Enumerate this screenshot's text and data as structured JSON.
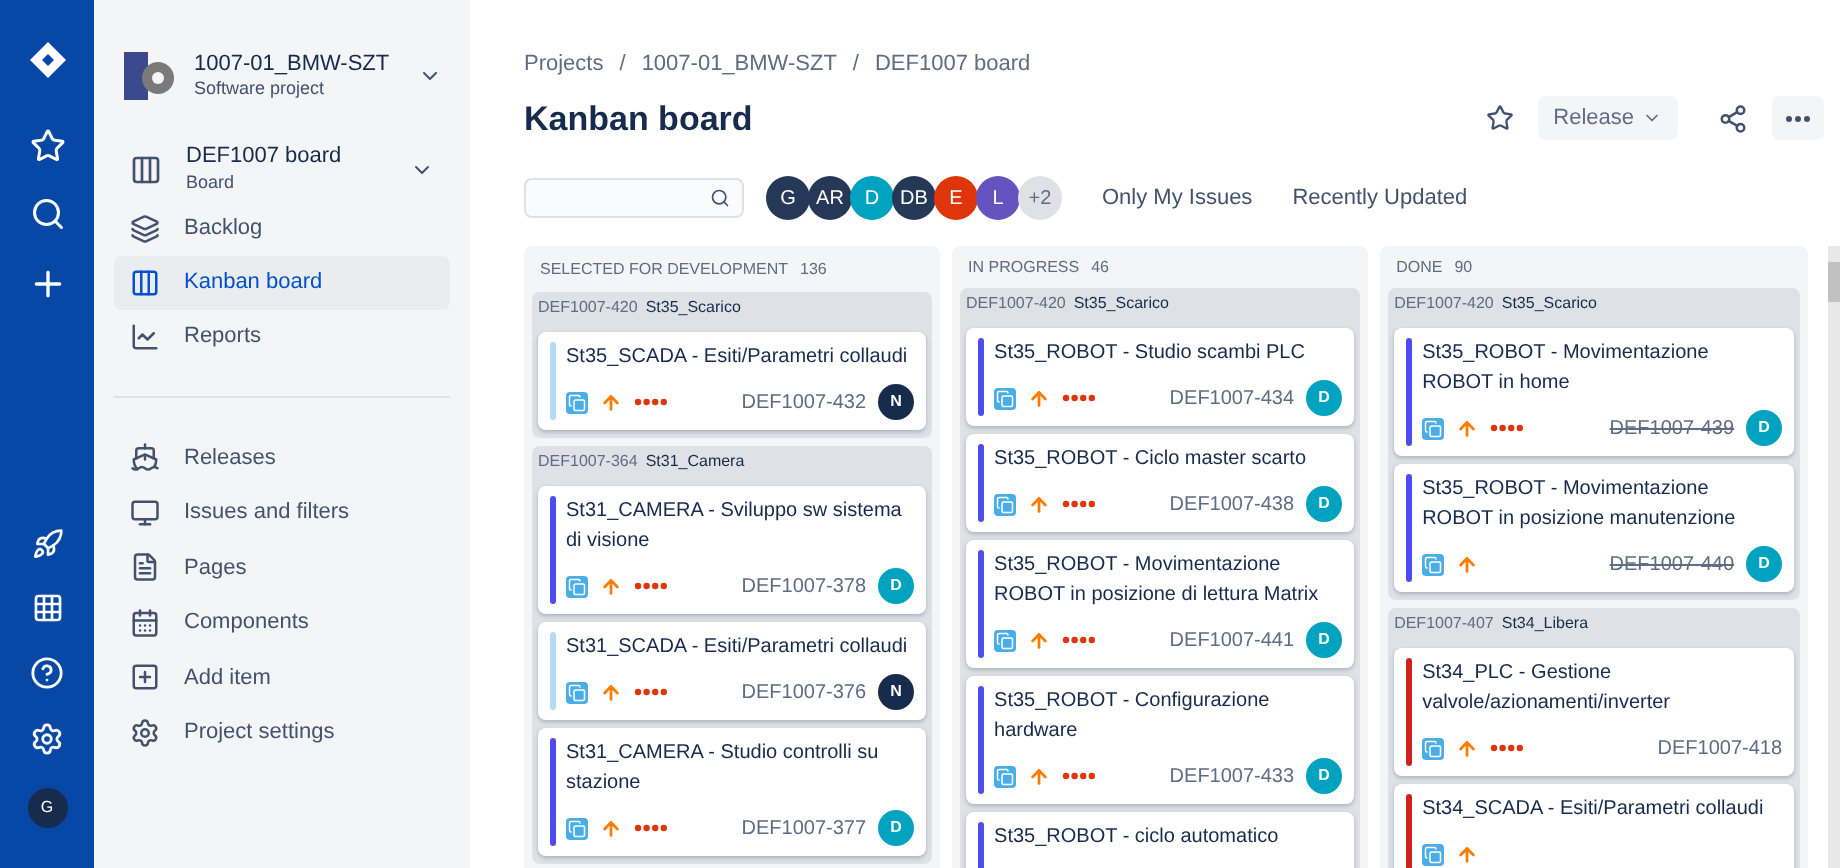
{
  "project": {
    "name": "1007-01_BMW-SZT",
    "type": "Software project"
  },
  "board_switcher": {
    "name": "DEF1007 board",
    "type": "Board"
  },
  "sidebar": {
    "items": [
      {
        "label": "Backlog",
        "selected": false
      },
      {
        "label": "Kanban board",
        "selected": true
      },
      {
        "label": "Reports",
        "selected": false
      }
    ],
    "items_2": [
      "Releases",
      "Issues and filters",
      "Pages",
      "Components",
      "Add item",
      "Project settings"
    ]
  },
  "global_nav": {
    "avatar": "G"
  },
  "breadcrumbs": [
    "Projects",
    "/",
    "1007-01_BMW-SZT",
    "/",
    "DEF1007 board"
  ],
  "title": "Kanban board",
  "release_button": "Release",
  "avatars": [
    {
      "label": "G",
      "color": "#253858"
    },
    {
      "label": "AR",
      "color": "#253858"
    },
    {
      "label": "D",
      "color": "#00a3bf"
    },
    {
      "label": "DB",
      "color": "#253858"
    },
    {
      "label": "E",
      "color": "#de350b"
    },
    {
      "label": "L",
      "color": "#6554c0"
    },
    {
      "label": "+2",
      "color": "#dfe1e6"
    }
  ],
  "quick_filters": [
    "Only My Issues",
    "Recently Updated"
  ],
  "columns": [
    {
      "title": "SELECTED FOR DEVELOPMENT",
      "count": "136",
      "lanes": [
        {
          "key": "DEF1007-420",
          "name": "St35_Scarico",
          "cards": [
            {
              "title": "St35_SCADA - Esiti/Parametri collaudi",
              "key": "DEF1007-432",
              "color": "#b3dcf5",
              "dots": true,
              "resolved": false,
              "avatar": {
                "label": "N",
                "color": "#172b4d"
              }
            }
          ]
        },
        {
          "key": "DEF1007-364",
          "name": "St31_Camera",
          "cards": [
            {
              "title": "St31_CAMERA - Sviluppo sw sistema di visione",
              "key": "DEF1007-378",
              "color": "#4c4cf0",
              "dots": true,
              "resolved": false,
              "avatar": {
                "label": "D",
                "color": "#00a3bf"
              }
            },
            {
              "title": "St31_SCADA - Esiti/Parametri collaudi",
              "key": "DEF1007-376",
              "color": "#b3dcf5",
              "dots": true,
              "resolved": false,
              "avatar": {
                "label": "N",
                "color": "#172b4d"
              }
            },
            {
              "title": "St31_CAMERA - Studio controlli su stazione",
              "key": "DEF1007-377",
              "color": "#4c4cf0",
              "dots": true,
              "resolved": false,
              "avatar": {
                "label": "D",
                "color": "#00a3bf"
              }
            }
          ]
        }
      ]
    },
    {
      "title": "IN PROGRESS",
      "count": "46",
      "lanes": [
        {
          "key": "DEF1007-420",
          "name": "St35_Scarico",
          "cards": [
            {
              "title": "St35_ROBOT - Studio scambi PLC",
              "key": "DEF1007-434",
              "color": "#4c4cf0",
              "dots": true,
              "resolved": false,
              "avatar": {
                "label": "D",
                "color": "#00a3bf"
              }
            },
            {
              "title": "St35_ROBOT - Ciclo master scarto",
              "key": "DEF1007-438",
              "color": "#4c4cf0",
              "dots": true,
              "resolved": false,
              "avatar": {
                "label": "D",
                "color": "#00a3bf"
              }
            },
            {
              "title": "St35_ROBOT - Movimentazione ROBOT in posizione di lettura Matrix",
              "key": "DEF1007-441",
              "color": "#4c4cf0",
              "dots": true,
              "resolved": false,
              "avatar": {
                "label": "D",
                "color": "#00a3bf"
              }
            },
            {
              "title": "St35_ROBOT - Configurazione hardware",
              "key": "DEF1007-433",
              "color": "#4c4cf0",
              "dots": true,
              "resolved": false,
              "avatar": {
                "label": "D",
                "color": "#00a3bf"
              }
            },
            {
              "title": "St35_ROBOT - ciclo automatico",
              "color": "#4c4cf0"
            }
          ]
        }
      ]
    },
    {
      "title": "DONE",
      "count": "90",
      "lanes": [
        {
          "key": "DEF1007-420",
          "name": "St35_Scarico",
          "cards": [
            {
              "title": "St35_ROBOT - Movimentazione ROBOT in home",
              "key": "DEF1007-439",
              "color": "#4c4cf0",
              "dots": true,
              "resolved": true,
              "avatar": {
                "label": "D",
                "color": "#00a3bf"
              }
            },
            {
              "title": "St35_ROBOT - Movimentazione ROBOT in posizione manutenzione",
              "key": "DEF1007-440",
              "color": "#4c4cf0",
              "dots": false,
              "resolved": true,
              "avatar": {
                "label": "D",
                "color": "#00a3bf"
              }
            }
          ]
        },
        {
          "key": "DEF1007-407",
          "name": "St34_Libera",
          "cards": [
            {
              "title": "St34_PLC - Gestione valvole/azionamenti/inverter",
              "key": "DEF1007-418",
              "color": "#d0201f",
              "dots": true,
              "resolved": false
            },
            {
              "title": "St34_SCADA - Esiti/Parametri collaudi",
              "color": "#d0201f"
            }
          ]
        }
      ]
    }
  ]
}
